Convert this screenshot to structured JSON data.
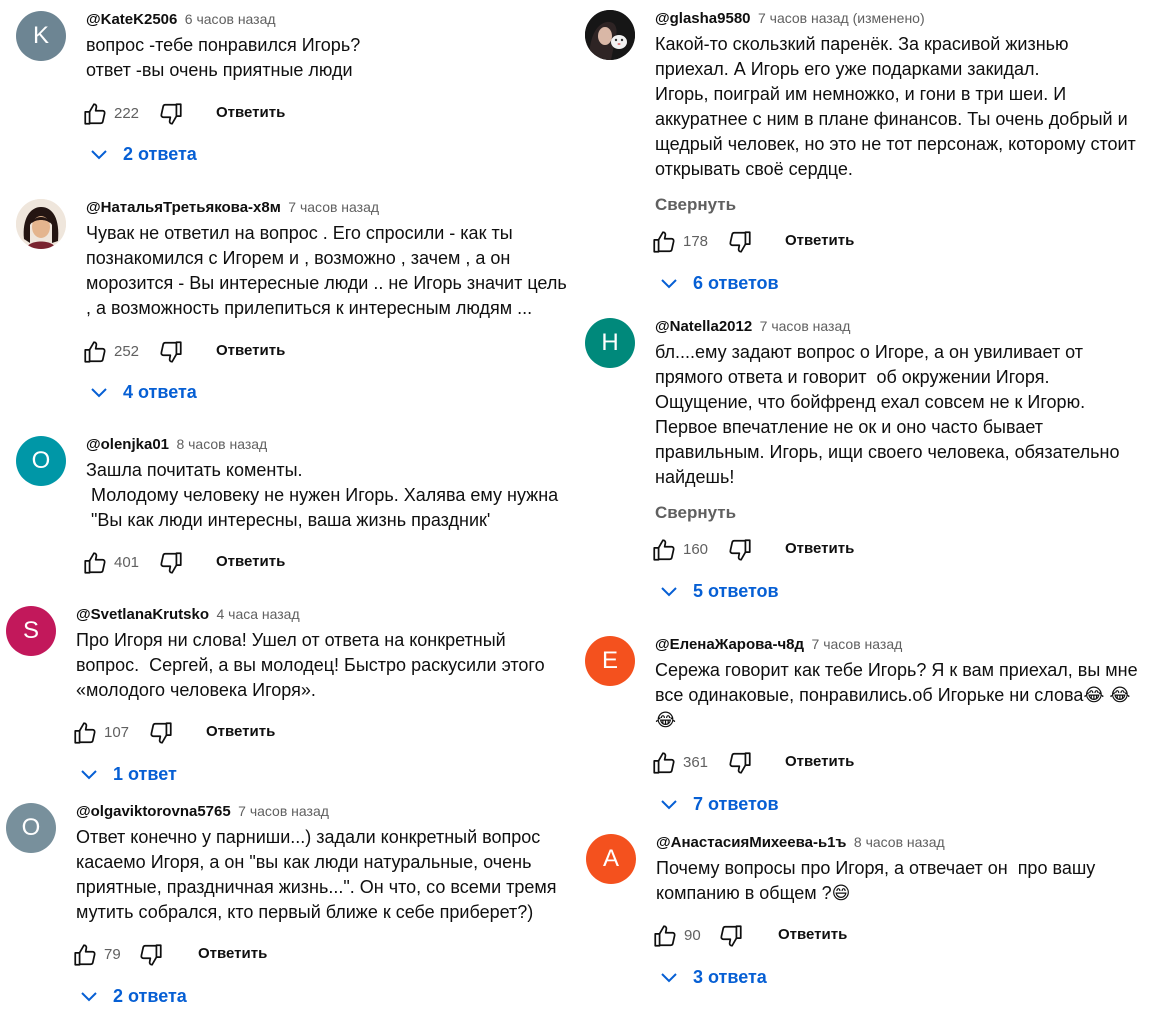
{
  "ui": {
    "reply_label": "Ответить",
    "collapse_label": "Свернуть"
  },
  "colors": {
    "link_blue": "#065fd4",
    "secondary_text": "#606060",
    "avatar_k": "#6d8593",
    "avatar_o_teal": "#0097a7",
    "avatar_s": "#c2185b",
    "avatar_o_grey": "#78909c",
    "avatar_n": "#00897b",
    "avatar_e": "#f4511e",
    "avatar_a": "#f4511e"
  },
  "left_column": [
    {
      "author": "@KateK2506",
      "time": "6 часов назад",
      "avatar_letter": "K",
      "lines": [
        "вопрос -тебе понравился Игорь?",
        "ответ -вы очень приятные люди"
      ],
      "likes": "222",
      "replies": "2 ответа"
    },
    {
      "author": "@НатальяТретьякова-х8м",
      "time": "7 часов назад",
      "avatar_letter": "",
      "lines": [
        "Чувак не ответил на вопрос . Его спросили - как ты",
        "познакомился с Игорем и , возможно , зачем , а он",
        "морозится - Вы интересные люди .. не Игорь значит цель",
        ", а возможность прилепиться к интересным людям ..."
      ],
      "likes": "252",
      "replies": "4 ответа"
    },
    {
      "author": "@olenjka01",
      "time": "8 часов назад",
      "avatar_letter": "O",
      "lines": [
        "Зашла почитать коменты.",
        " Молодому человеку не нужен Игорь. Халява ему нужна",
        " \"Вы как люди интересны, ваша жизнь праздник'"
      ],
      "likes": "401",
      "replies": ""
    },
    {
      "author": "@SvetlanaKrutsko",
      "time": "4 часа назад",
      "avatar_letter": "S",
      "lines": [
        "Про Игоря ни слова! Ушел от ответа на конкретный",
        "вопрос.  Сергей, а вы молодец! Быстро раскусили этого",
        "«молодого человека Игоря»."
      ],
      "likes": "107",
      "replies": "1 ответ"
    },
    {
      "author": "@olgaviktorovna5765",
      "time": "7 часов назад",
      "avatar_letter": "O",
      "lines": [
        "Ответ конечно у парниши...) задали конкретный вопрос",
        "касаемо Игоря, а он \"вы как люди натуральные, очень",
        "приятные, праздничная жизнь...\". Он что, со всеми тремя",
        "мутить собрался, кто первый ближе к себе приберет?)"
      ],
      "likes": "79",
      "replies": "2 ответа"
    }
  ],
  "right_column": [
    {
      "author": "@glasha9580",
      "time": "7 часов назад (изменено)",
      "avatar_letter": "",
      "lines": [
        "Какой-то скользкий паренёк. За красивой жизнью",
        "приехал. А Игорь его уже подарками закидал.",
        "Игорь, поиграй им немножко, и гони в три шеи. И",
        "аккуратнее с ним в плане финансов. Ты очень добрый и",
        "щедрый человек, но это не тот персонаж, которому стоит",
        "открывать своё сердце."
      ],
      "likes": "178",
      "replies": "6 ответов"
    },
    {
      "author": "@Natella2012",
      "time": "7 часов назад",
      "avatar_letter": "Н",
      "lines": [
        "бл....ему задают вопрос о Игоре, а он увиливает от",
        "прямого ответа и говорит  об окружении Игоря.",
        "Ощущение, что бойфренд ехал совсем не к Игорю.",
        "Первое впечатление не ок и оно часто бывает",
        "правильным. Игорь, ищи своего человека, обязательно",
        "найдешь!"
      ],
      "likes": "160",
      "replies": "5 ответов"
    },
    {
      "author": "@ЕленаЖарова-ч8д",
      "time": "7 часов назад",
      "avatar_letter": "Е",
      "lines": [
        "Сережа говорит как тебе Игорь? Я к вам приехал, вы мне",
        "все одинаковые, понравились.об Игорьке ни слова😂 😂",
        "😂"
      ],
      "likes": "361",
      "replies": "7 ответов"
    },
    {
      "author": "@АнастасияМихеева-ь1ъ",
      "time": "8 часов назад",
      "avatar_letter": "А",
      "lines": [
        "Почему вопросы про Игоря, а отвечает он  про вашу",
        "компанию в общем ?😄"
      ],
      "likes": "90",
      "replies": "3 ответа"
    }
  ]
}
